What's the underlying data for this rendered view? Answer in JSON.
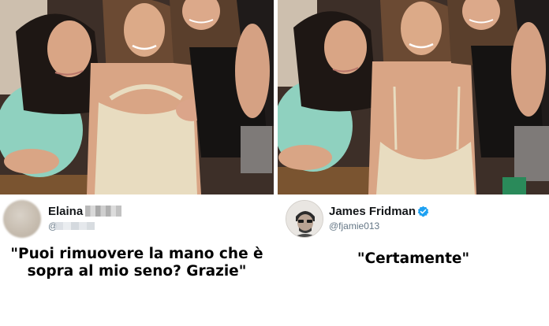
{
  "left": {
    "tweet": {
      "name": "Elaina",
      "handle": "@"
    },
    "caption": "\"Puoi rimuovere la mano che è sopra al mio seno? Grazie\""
  },
  "right": {
    "tweet": {
      "name": "James Fridman",
      "handle": "@fjamie013",
      "verified_icon": "verified-badge-icon"
    },
    "caption": "\"Certamente\""
  },
  "colors": {
    "name_text": "#14171a",
    "handle_text": "#657786",
    "verified_blue": "#1da1f2"
  }
}
